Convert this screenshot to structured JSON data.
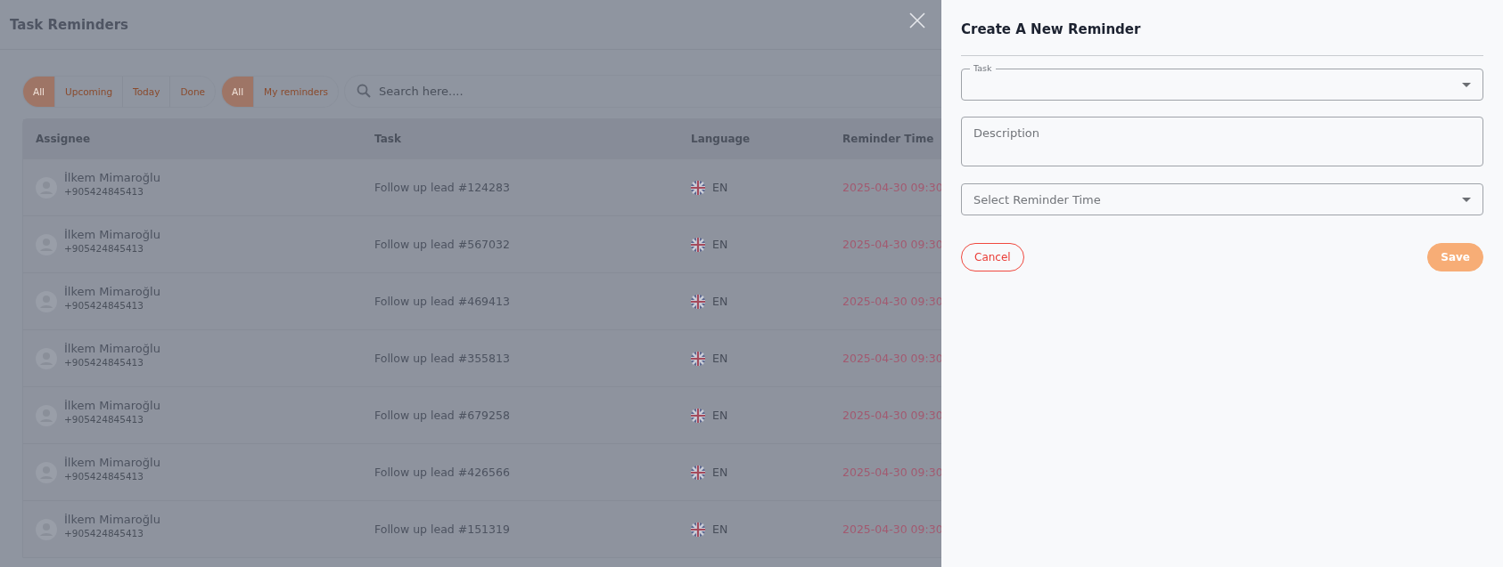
{
  "page": {
    "title": "Task Reminders"
  },
  "filters": [
    {
      "options": [
        {
          "label": "All",
          "selected": true
        },
        {
          "label": "Upcoming",
          "selected": false
        },
        {
          "label": "Today",
          "selected": false
        },
        {
          "label": "Done",
          "selected": false
        }
      ]
    },
    {
      "options": [
        {
          "label": "All",
          "selected": true
        },
        {
          "label": "My reminders",
          "selected": false
        }
      ]
    }
  ],
  "search": {
    "placeholder": "Search here...."
  },
  "table": {
    "columns": [
      "Assignee",
      "Task",
      "Language",
      "Reminder Time"
    ],
    "rows": [
      {
        "name": "İlkem Mimaroğlu",
        "phone": "+905424845413",
        "task": "Follow up lead #124283",
        "language": "EN",
        "time": "2025-04-30 09:30"
      },
      {
        "name": "İlkem Mimaroğlu",
        "phone": "+905424845413",
        "task": "Follow up lead #567032",
        "language": "EN",
        "time": "2025-04-30 09:30"
      },
      {
        "name": "İlkem Mimaroğlu",
        "phone": "+905424845413",
        "task": "Follow up lead #469413",
        "language": "EN",
        "time": "2025-04-30 09:30"
      },
      {
        "name": "İlkem Mimaroğlu",
        "phone": "+905424845413",
        "task": "Follow up lead #355813",
        "language": "EN",
        "time": "2025-04-30 09:30"
      },
      {
        "name": "İlkem Mimaroğlu",
        "phone": "+905424845413",
        "task": "Follow up lead #679258",
        "language": "EN",
        "time": "2025-04-30 09:30"
      },
      {
        "name": "İlkem Mimaroğlu",
        "phone": "+905424845413",
        "task": "Follow up lead #426566",
        "language": "EN",
        "time": "2025-04-30 09:30"
      },
      {
        "name": "İlkem Mimaroğlu",
        "phone": "+905424845413",
        "task": "Follow up lead #151319",
        "language": "EN",
        "time": "2025-04-30 09:30"
      }
    ]
  },
  "drawer": {
    "title": "Create A New Reminder",
    "fields": [
      {
        "kind": "select",
        "label": "Task"
      },
      {
        "kind": "textarea",
        "placeholder": "Description"
      },
      {
        "kind": "select",
        "placeholder": "Select Reminder Time"
      }
    ],
    "buttons": [
      {
        "kind": "cancel",
        "label": "Cancel"
      },
      {
        "kind": "save",
        "label": "Save"
      }
    ]
  }
}
